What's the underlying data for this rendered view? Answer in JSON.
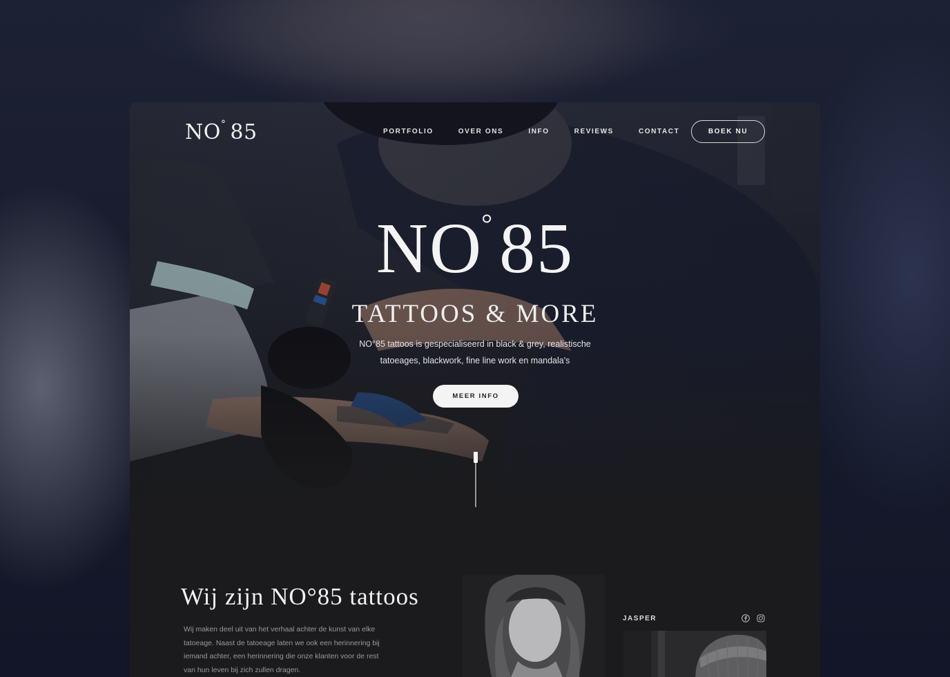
{
  "nav": {
    "logo": "NO",
    "logo_degree": "°",
    "logo_number": "85",
    "items": [
      {
        "label": "PORTFOLIO"
      },
      {
        "label": "OVER ONS"
      },
      {
        "label": "INFO"
      },
      {
        "label": "REVIEWS"
      },
      {
        "label": "CONTACT"
      }
    ],
    "book_button": "BOEK NU"
  },
  "hero": {
    "title": "NO",
    "title_degree": "°",
    "title_number": "85",
    "subtitle": "TATTOOS & MORE",
    "description_line1": "NO°85 tattoos is gespecialiseerd in black & grey, realistische",
    "description_line2": "tatoeages, blackwork, fine line work en mandala's",
    "more_button": "MEER INFO"
  },
  "about": {
    "title": "Wij zijn NO°85 tattoos",
    "text_lines": [
      "Wij maken deel uit van het verhaal achter de kunst van elke",
      "tatoeage.  Naast de tatoeage laten we ook een herinnering bij",
      "iemand achter, een herinnering die onze klanten voor de rest",
      "van hun leven bij zich zullen dragen."
    ]
  },
  "artist": {
    "name": "JASPER",
    "social": [
      "facebook-icon",
      "instagram-icon"
    ]
  },
  "colors": {
    "page_background": "#1b1b1d",
    "text_primary": "#f2f2f2",
    "text_muted": "#9a9a9e"
  }
}
